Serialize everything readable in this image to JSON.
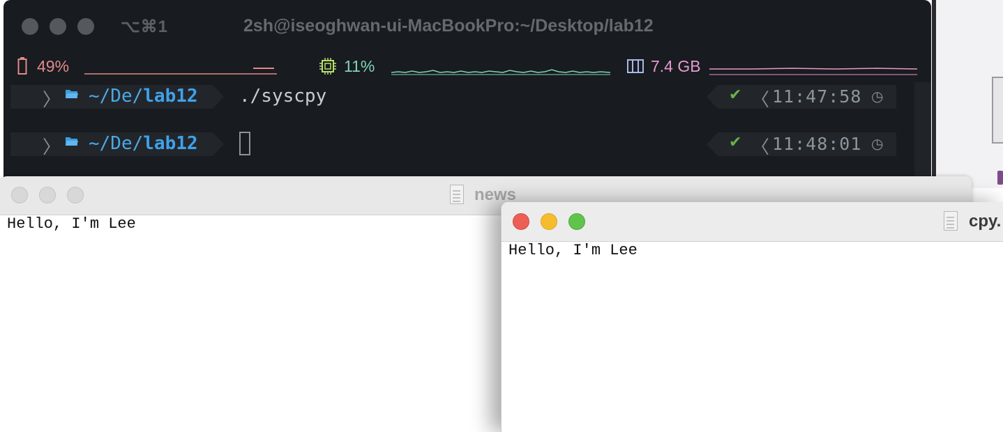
{
  "terminal": {
    "shortcut": "⌥⌘1",
    "title": "2sh@iseoghwan-ui-MacBookPro:~/Desktop/lab12",
    "status": {
      "battery": {
        "label": "49%",
        "color": "#e08a8a"
      },
      "cpu": {
        "label": "11%",
        "color": "#7fd4b6"
      },
      "memory": {
        "label": "7.4 GB",
        "color": "#e59ad0"
      }
    },
    "prompts": [
      {
        "path_prefix": "~/De/",
        "path_dir": "lab12",
        "command": "./syscpy",
        "time": "11:47:58",
        "status": "✔"
      },
      {
        "path_prefix": "~/De/",
        "path_dir": "lab12",
        "command": "",
        "time": "11:48:01",
        "status": "✔"
      }
    ]
  },
  "news_window": {
    "title": "news",
    "content": "Hello, I'm Lee"
  },
  "cpy_window": {
    "title": "cpy.",
    "content": "Hello, I'm Lee",
    "buttons": {
      "close": "#ec5f57",
      "minimize": "#f5bd2e",
      "zoom": "#60c44c"
    }
  }
}
